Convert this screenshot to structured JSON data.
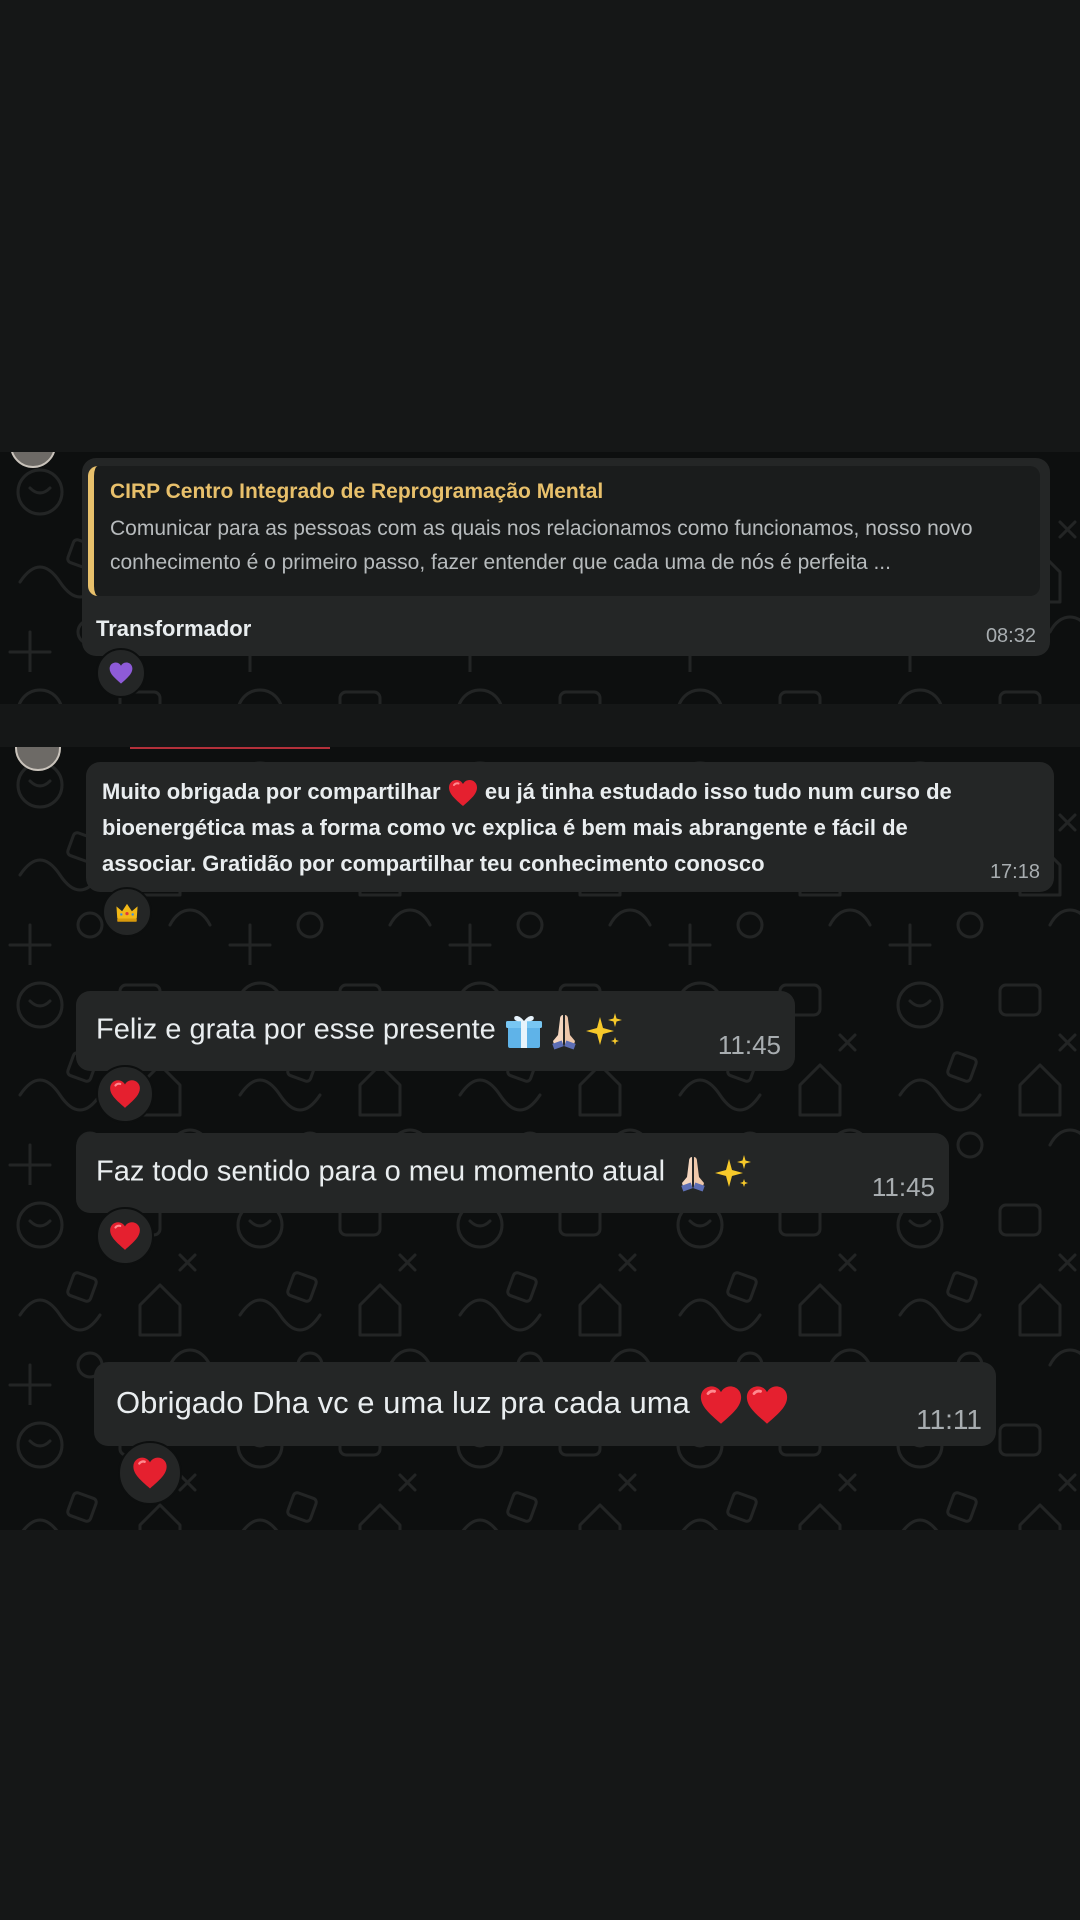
{
  "screenshot_1": {
    "quoted": {
      "author": "CIRP Centro Integrado de Reprogramação Mental",
      "text": "Comunicar para as pessoas com as quais nos relacionamos como funcionamos, nosso novo conhecimento é o primeiro passo, fazer entender que cada uma de nós é perfeita ..."
    },
    "message": "Transformador",
    "time": "08:32",
    "reaction": "purple-heart-icon"
  },
  "screenshot_2": {
    "message_part1": "Muito obrigada por compartilhar",
    "message_part2": "eu já tinha estudado isso tudo num curso de",
    "message_line2": "bioenergética mas a forma como vc explica é bem mais abrangente e fácil de",
    "message_line3": "associar. Gratidão por compartilhar teu conhecimento conosco",
    "time": "17:18",
    "reaction": "crown-icon"
  },
  "screenshot_3": {
    "messages": [
      {
        "text": "Feliz e grata por esse presente",
        "time": "11:45",
        "reaction": "red-heart-icon",
        "emojis": [
          "gift-icon",
          "praying-hands-icon",
          "sparkles-icon"
        ]
      },
      {
        "text": "Faz todo sentido para o meu momento atual",
        "time": "11:45",
        "reaction": "red-heart-icon",
        "emojis": [
          "praying-hands-icon",
          "sparkles-icon"
        ]
      }
    ]
  },
  "screenshot_4": {
    "message": "Obrigado  Dha vc e uma luz pra cada uma",
    "time": "11:11",
    "reaction": "red-heart-icon",
    "emojis": [
      "red-heart-icon",
      "red-heart-icon"
    ]
  }
}
